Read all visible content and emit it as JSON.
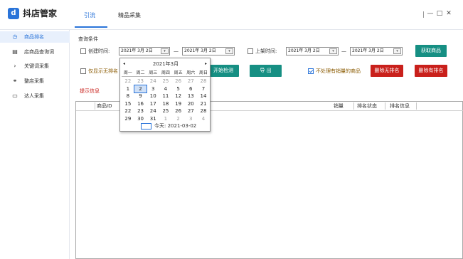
{
  "app": {
    "title": "抖店管家",
    "logo_char": "d"
  },
  "tabs": [
    {
      "label": "引流",
      "active": true
    },
    {
      "label": "精品采集",
      "active": false
    }
  ],
  "window_controls": {
    "min": "—",
    "max": "□",
    "close": "✕"
  },
  "sidebar": {
    "items": [
      {
        "label": "商品排名",
        "icon": "clock-icon",
        "glyph": "◷",
        "active": true
      },
      {
        "label": "店商品查询词",
        "icon": "document-icon",
        "glyph": "▤",
        "active": false
      },
      {
        "label": "关键词采集",
        "icon": "chevron-right-icon",
        "glyph": "›",
        "active": false
      },
      {
        "label": "整店采集",
        "icon": "share-icon",
        "glyph": "⚭",
        "active": false
      },
      {
        "label": "达人采集",
        "icon": "folder-icon",
        "glyph": "▭",
        "active": false
      }
    ]
  },
  "query": {
    "section_label": "查询条件",
    "create_time_label": "创建时间:",
    "create_from": "2021年 3月 2日",
    "create_to": "2021年 3月 2日",
    "dash": "—",
    "shelf_time_label": "上架时间:",
    "shelf_from": "2021年 3月 2日",
    "shelf_to": "2021年 3月 2日",
    "get_goods_button": "获取商品",
    "only_unranked_label": "仅显示无排名",
    "start_check_button": "开始检测",
    "export_button": "导 出",
    "no_sales_label": "不处理有销量的商品",
    "no_sales_checked": true,
    "delete_unranked_button": "删除无排名",
    "delete_ranked_button": "删除有排名",
    "dd_glyph": "▾"
  },
  "tip_label": "提示信息",
  "table": {
    "columns": [
      "商品ID",
      "销量",
      "排名状态",
      "排名信息"
    ]
  },
  "calendar": {
    "title": "2021年3月",
    "prev": "◂",
    "next": "▸",
    "weekdays": [
      "周一",
      "周二",
      "周三",
      "周四",
      "周五",
      "周六",
      "周日"
    ],
    "weeks": [
      [
        "22",
        "23",
        "24",
        "25",
        "26",
        "27",
        "28"
      ],
      [
        "1",
        "2",
        "3",
        "4",
        "5",
        "6",
        "7"
      ],
      [
        "8",
        "9",
        "10",
        "11",
        "12",
        "13",
        "14"
      ],
      [
        "15",
        "16",
        "17",
        "18",
        "19",
        "20",
        "21"
      ],
      [
        "22",
        "23",
        "24",
        "25",
        "26",
        "27",
        "28"
      ],
      [
        "29",
        "30",
        "31",
        "1",
        "2",
        "3",
        "4"
      ]
    ],
    "selected": "2",
    "today_label": "今天: 2021-03-02"
  },
  "colors": {
    "accent": "#2a74d9",
    "teal_button": "#168f83",
    "red_button": "#c9201b",
    "tip_text": "#c9201b"
  }
}
